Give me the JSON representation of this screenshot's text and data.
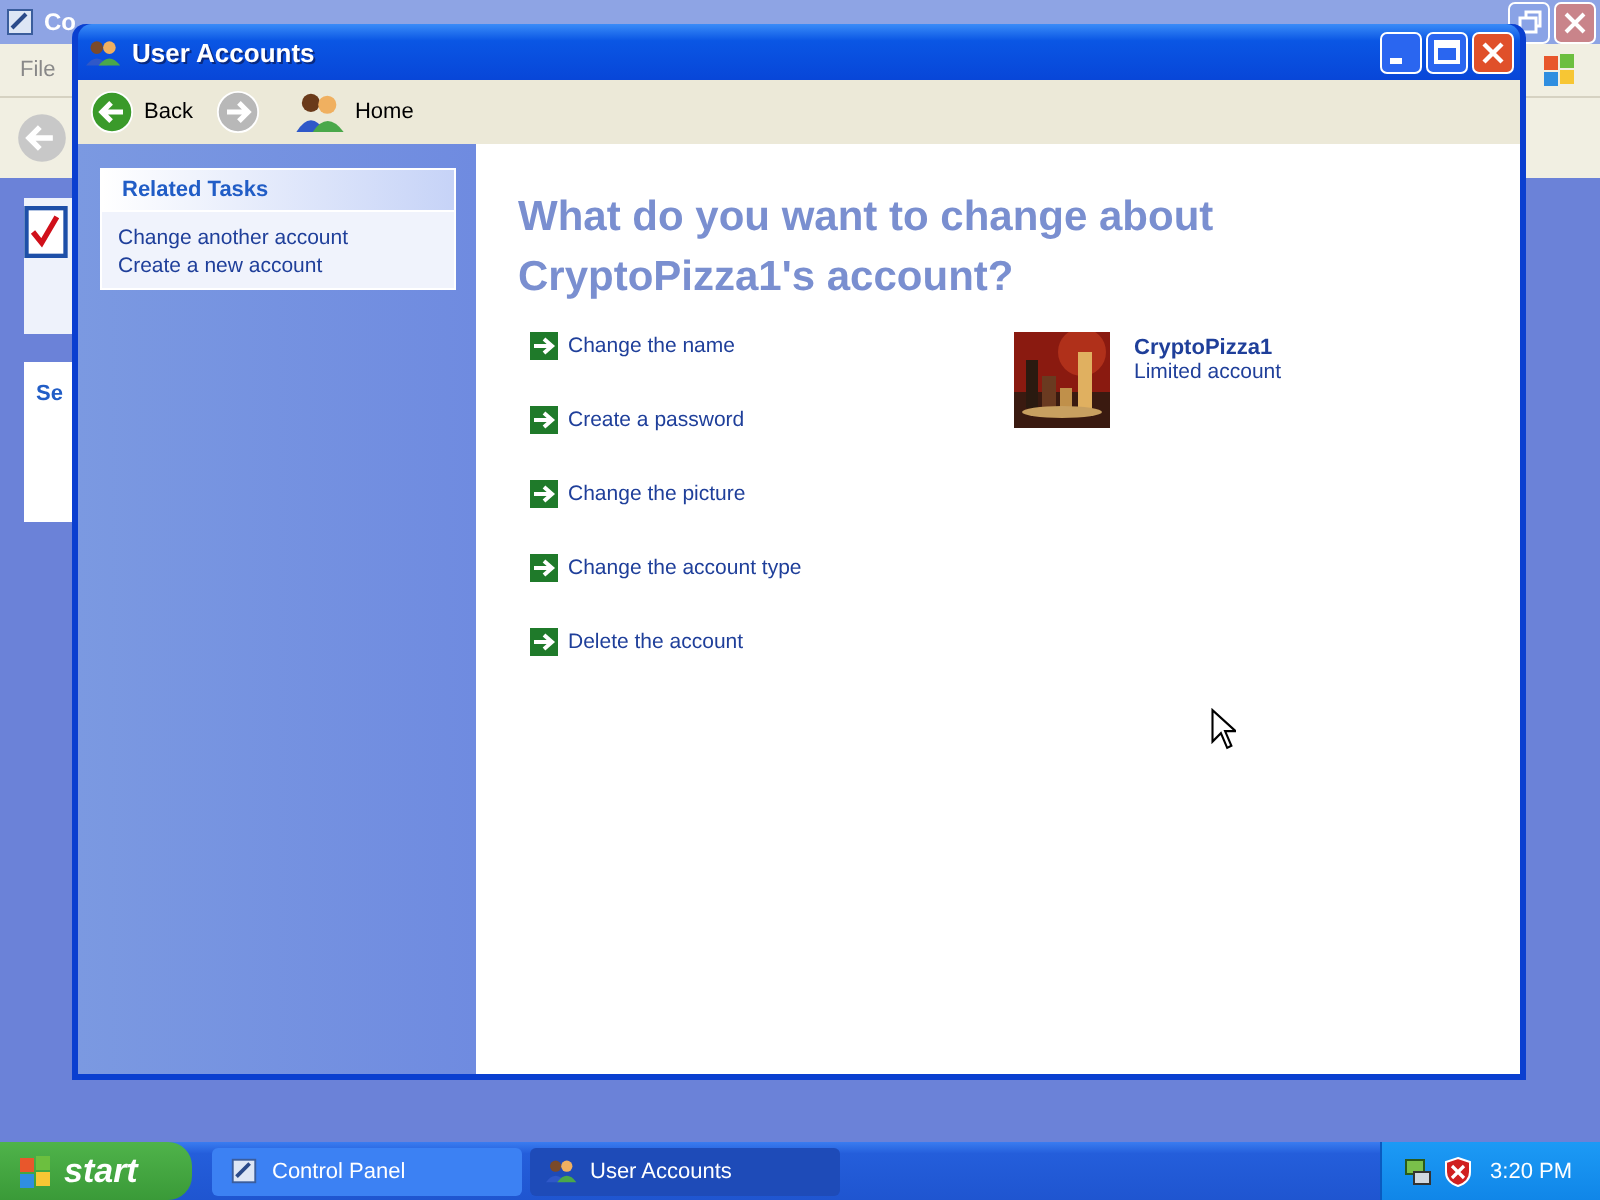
{
  "background_window": {
    "title": "Co",
    "menu": [
      "File"
    ],
    "side_card_title": "Se"
  },
  "window": {
    "title": "User Accounts"
  },
  "toolbar": [
    {
      "kind": "back",
      "label": "Back",
      "disabled": false
    },
    {
      "kind": "forward",
      "disabled": true
    },
    {
      "kind": "home",
      "label": "Home"
    }
  ],
  "related_tasks": {
    "title": "Related Tasks",
    "items": [
      "Change another account",
      "Create a new account"
    ]
  },
  "heading": "What do you want to change about CryptoPizza1's account?",
  "actions": [
    "Change the name",
    "Create a password",
    "Change the picture",
    "Change the account type",
    "Delete the account"
  ],
  "account": {
    "name": "CryptoPizza1",
    "type": "Limited account"
  },
  "taskbar": {
    "start": "start",
    "tasks": [
      {
        "label": "Control Panel",
        "selected": false,
        "kind": "control-panel"
      },
      {
        "label": "User Accounts",
        "selected": true,
        "kind": "users"
      }
    ],
    "clock": "3:20 PM"
  }
}
